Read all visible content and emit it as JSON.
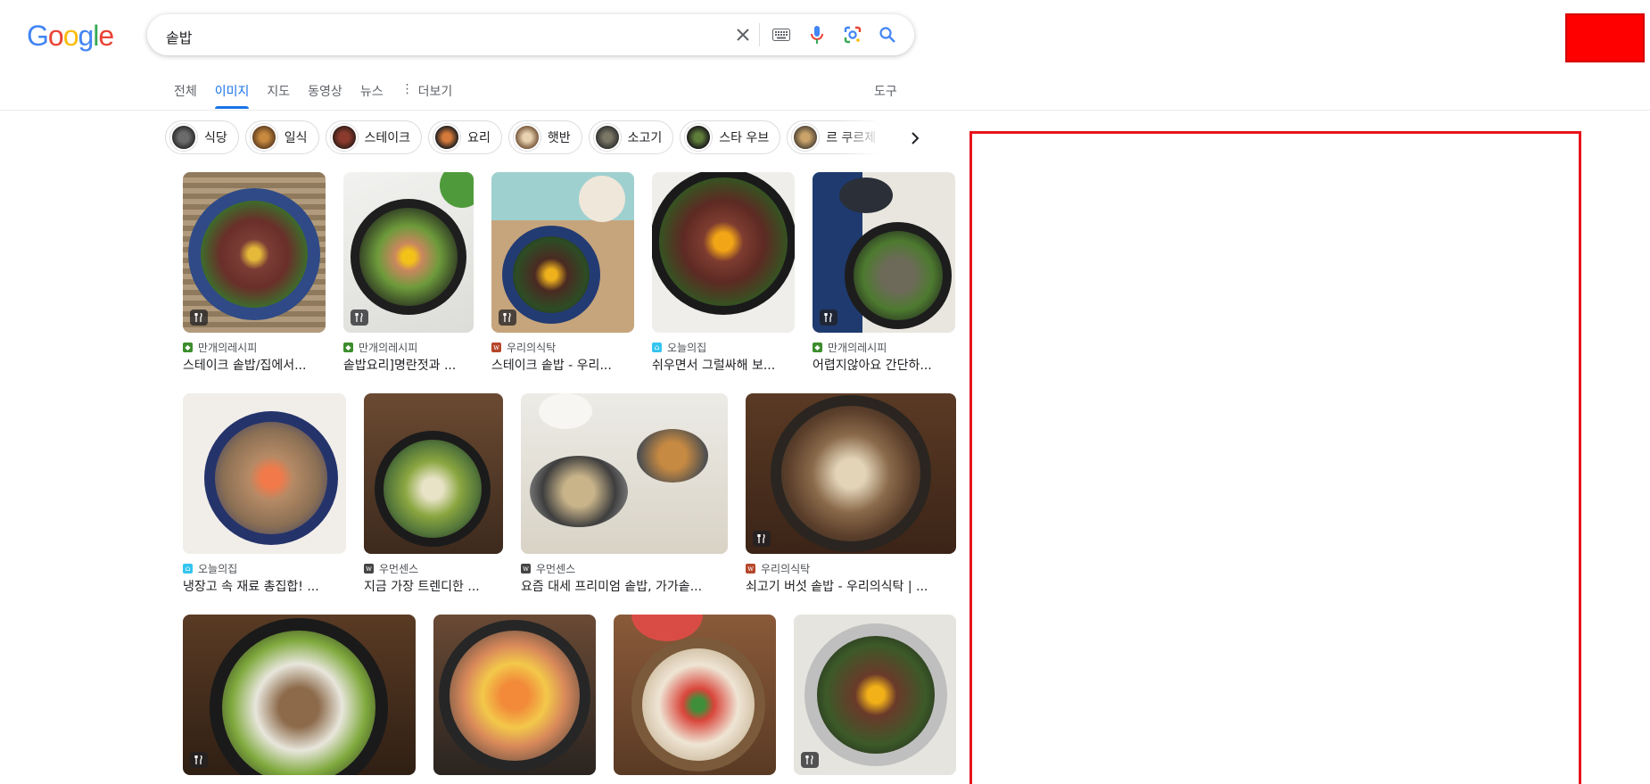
{
  "logo": "Google",
  "search": {
    "query": "솥밥"
  },
  "header_icons": [
    "clear-icon",
    "keyboard-icon",
    "microphone-icon",
    "lens-icon",
    "search-icon"
  ],
  "tabs": [
    {
      "label": "전체",
      "active": false
    },
    {
      "label": "이미지",
      "active": true
    },
    {
      "label": "지도",
      "active": false
    },
    {
      "label": "동영상",
      "active": false
    },
    {
      "label": "뉴스",
      "active": false
    },
    {
      "label": "더보기",
      "active": false
    }
  ],
  "tools_label": "도구",
  "chips": [
    {
      "label": "식당"
    },
    {
      "label": "일식"
    },
    {
      "label": "스테이크"
    },
    {
      "label": "요리"
    },
    {
      "label": "햇반"
    },
    {
      "label": "소고기"
    },
    {
      "label": "스타 우브"
    },
    {
      "label": "르 쿠르제"
    }
  ],
  "results": [
    [
      {
        "source": "만개의레시피",
        "title": "스테이크 솥밥/집에서...",
        "recipe": true
      },
      {
        "source": "만개의레시피",
        "title": "솥밥요리]명란젓과 ...",
        "recipe": true
      },
      {
        "source": "우리의식탁",
        "title": "스테이크 솥밥 - 우리...",
        "recipe": true
      },
      {
        "source": "오늘의집",
        "title": "쉬우면서 그럴싸해 보...",
        "recipe": false
      },
      {
        "source": "만개의레시피",
        "title": "어렵지않아요 간단하...",
        "recipe": true
      }
    ],
    [
      {
        "source": "오늘의집",
        "title": "냉장고 속 재료 총집합! ...",
        "recipe": false
      },
      {
        "source": "우먼센스",
        "title": "지금 가장 트렌디한 ...",
        "recipe": false
      },
      {
        "source": "우먼센스",
        "title": "요즘 대세 프리미엄 솥밥, 가가솥...",
        "recipe": false
      },
      {
        "source": "우리의식탁",
        "title": "쇠고기 버섯 솥밥 - 우리의식탁 | ...",
        "recipe": true
      }
    ],
    [
      {
        "source": "",
        "title": "",
        "recipe": true
      },
      {
        "source": "",
        "title": "",
        "recipe": false
      },
      {
        "source": "",
        "title": "",
        "recipe": false
      },
      {
        "source": "",
        "title": "",
        "recipe": true
      }
    ]
  ],
  "colors": {
    "accent": "#1a73e8",
    "red_overlay": "#ff0000",
    "fav_10000recipe": "#3c8c2c",
    "fav_ohouse": "#35c5f0",
    "fav_woori": "#b5462a",
    "fav_womansense": "#444444"
  }
}
